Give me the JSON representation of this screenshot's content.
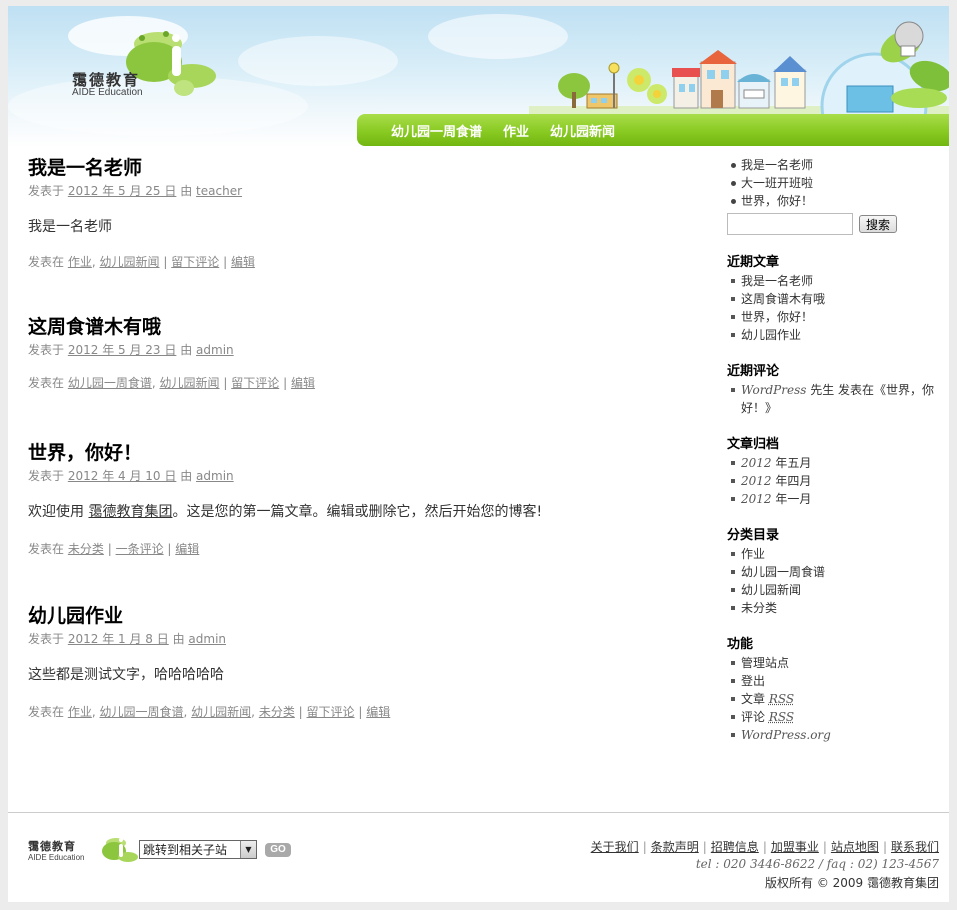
{
  "header": {
    "logo_cn": "霭德教育",
    "logo_en": "AIDE Education",
    "nav": [
      "幼儿园一周食谱",
      "作业",
      "幼儿园新闻"
    ]
  },
  "posts": [
    {
      "title": "我是一名老师",
      "posted_on": "发表于",
      "date": "2012 年 5 月 25 日",
      "by": "由",
      "author": "teacher",
      "body": "我是一名老师",
      "filed": "发表在",
      "categories": [
        "作业",
        "幼儿园新闻"
      ],
      "comment": "留下评论",
      "edit": "编辑"
    },
    {
      "title": "这周食谱木有哦",
      "posted_on": "发表于",
      "date": "2012 年 5 月 23 日",
      "by": "由",
      "author": "admin",
      "body": "",
      "filed": "发表在",
      "categories": [
        "幼儿园一周食谱",
        "幼儿园新闻"
      ],
      "comment": "留下评论",
      "edit": "编辑"
    },
    {
      "title": "世界，你好！",
      "posted_on": "发表于",
      "date": "2012 年 4 月 10 日",
      "by": "由",
      "author": "admin",
      "body_pre": "欢迎使用 ",
      "body_link": "霭德教育集团",
      "body_post": "。这是您的第一篇文章。编辑或删除它，然后开始您的博客!",
      "filed": "发表在",
      "categories": [
        "未分类"
      ],
      "comment": "一条评论",
      "edit": "编辑"
    },
    {
      "title": "幼儿园作业",
      "posted_on": "发表于",
      "date": "2012 年 1 月 8 日",
      "by": "由",
      "author": "admin",
      "body": "这些都是测试文字，哈哈哈哈哈",
      "filed": "发表在",
      "categories": [
        "作业",
        "幼儿园一周食谱",
        "幼儿园新闻",
        "未分类"
      ],
      "comment": "留下评论",
      "edit": "编辑"
    }
  ],
  "sidebar": {
    "pages": [
      "我是一名老师",
      "大一班开班啦",
      "世界，你好！"
    ],
    "search_button": "搜索",
    "recent_posts_title": "近期文章",
    "recent_posts": [
      "我是一名老师",
      "这周食谱木有哦",
      "世界，你好！",
      "幼儿园作业"
    ],
    "recent_comments_title": "近期评论",
    "recent_comment_author": "WordPress",
    "recent_comment_text": " 先生 发表在《世界，你好！》",
    "archives_title": "文章归档",
    "archives": [
      {
        "year": "2012",
        "month": " 年五月"
      },
      {
        "year": "2012",
        "month": " 年四月"
      },
      {
        "year": "2012",
        "month": " 年一月"
      }
    ],
    "categories_title": "分类目录",
    "categories": [
      "作业",
      "幼儿园一周食谱",
      "幼儿园新闻",
      "未分类"
    ],
    "meta_title": "功能",
    "meta_links": [
      "管理站点",
      "登出"
    ],
    "meta_rss_posts_pre": "文章 ",
    "meta_rss_comments_pre": "评论 ",
    "rss": "RSS",
    "meta_wp": "WordPress.org"
  },
  "footer": {
    "logo_cn": "霭德教育",
    "logo_en": "AIDE Education",
    "jump_label": "跳转到相关子站",
    "go_label": "GO",
    "links": [
      "关于我们",
      "条款声明",
      "招聘信息",
      "加盟事业",
      "站点地图",
      "联系我们"
    ],
    "tel": "tel : 020 3446-8622 / faq : 02) 123-4567",
    "copyright": "版权所有 © 2009 霭德教育集团"
  }
}
